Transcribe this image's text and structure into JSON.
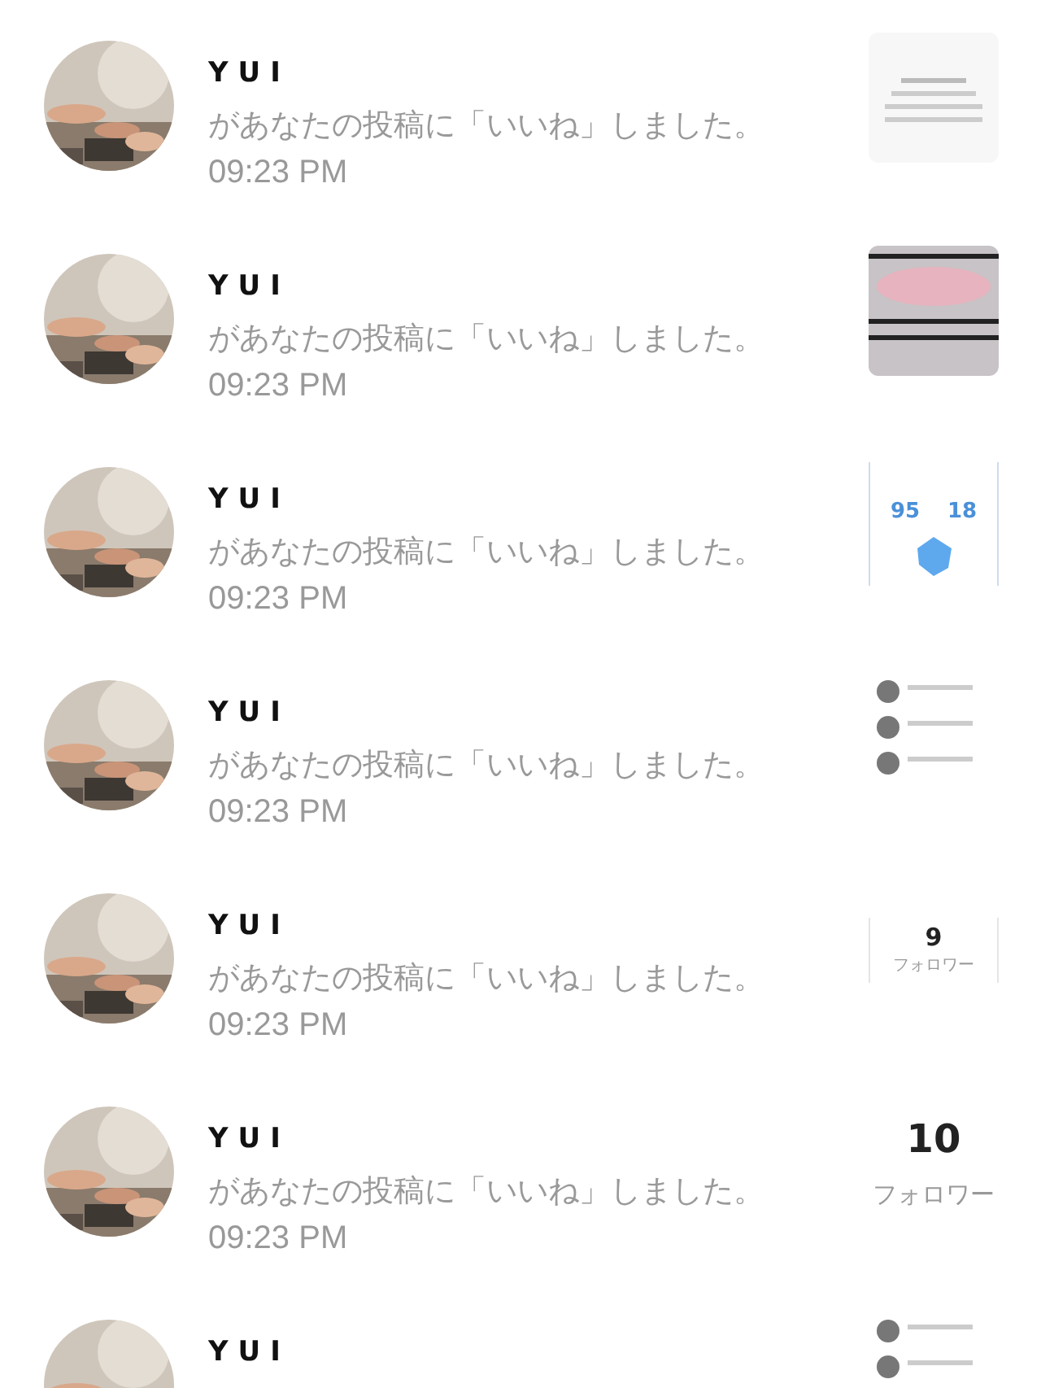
{
  "notifications": [
    {
      "name": "YUI",
      "message": "があなたの投稿に「いいね」しました。",
      "time": "09:23 PM"
    },
    {
      "name": "YUI",
      "message": "があなたの投稿に「いいね」しました。",
      "time": "09:23 PM"
    },
    {
      "name": "YUI",
      "message": "があなたの投稿に「いいね」しました。",
      "time": "09:23 PM",
      "thumbnail": {
        "kind": "stats",
        "values": [
          "95",
          "18"
        ]
      }
    },
    {
      "name": "YUI",
      "message": "があなたの投稿に「いいね」しました。",
      "time": "09:23 PM"
    },
    {
      "name": "YUI",
      "message": "があなたの投稿に「いいね」しました。",
      "time": "09:23 PM",
      "thumbnail": {
        "kind": "follower_card",
        "count": "9",
        "label": "フォロワー"
      }
    },
    {
      "name": "YUI",
      "message": "があなたの投稿に「いいね」しました。",
      "time": "09:23 PM",
      "thumbnail": {
        "kind": "followers",
        "count": "10",
        "label": "フォロワー"
      }
    },
    {
      "name": "YUI"
    }
  ]
}
